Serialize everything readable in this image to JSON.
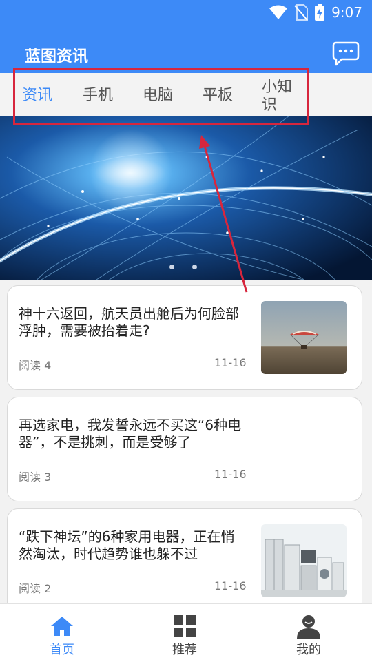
{
  "status": {
    "time": "9:07"
  },
  "app": {
    "title": "蓝图资讯"
  },
  "tabs": [
    {
      "label": "资讯",
      "active": true
    },
    {
      "label": "手机",
      "active": false
    },
    {
      "label": "电脑",
      "active": false
    },
    {
      "label": "平板",
      "active": false
    },
    {
      "label": "小知识",
      "active": false
    }
  ],
  "banner": {
    "dot_count": 2
  },
  "articles": [
    {
      "title": "神十六返回，航天员出舱后为何脸部浮肿，需要被抬着走?",
      "reads": "阅读 4",
      "date": "11-16",
      "thumbnail": "parachute-landing"
    },
    {
      "title": "再选家电，我发誓永远不买这“6种电器”，不是挑刺，而是受够了",
      "reads": "阅读 3",
      "date": "11-16",
      "thumbnail": ""
    },
    {
      "title": "“跌下神坛”的6种家用电器，正在悄然淘汰，时代趋势谁也躲不过",
      "reads": "阅读 2",
      "date": "11-16",
      "thumbnail": "home-appliances"
    }
  ],
  "bottom_nav": [
    {
      "label": "首页",
      "icon": "home-icon",
      "active": true
    },
    {
      "label": "推荐",
      "icon": "grid-icon",
      "active": false
    },
    {
      "label": "我的",
      "icon": "user-icon",
      "active": false
    }
  ],
  "colors": {
    "primary": "#3d8af7",
    "annotation": "#d7263d"
  }
}
